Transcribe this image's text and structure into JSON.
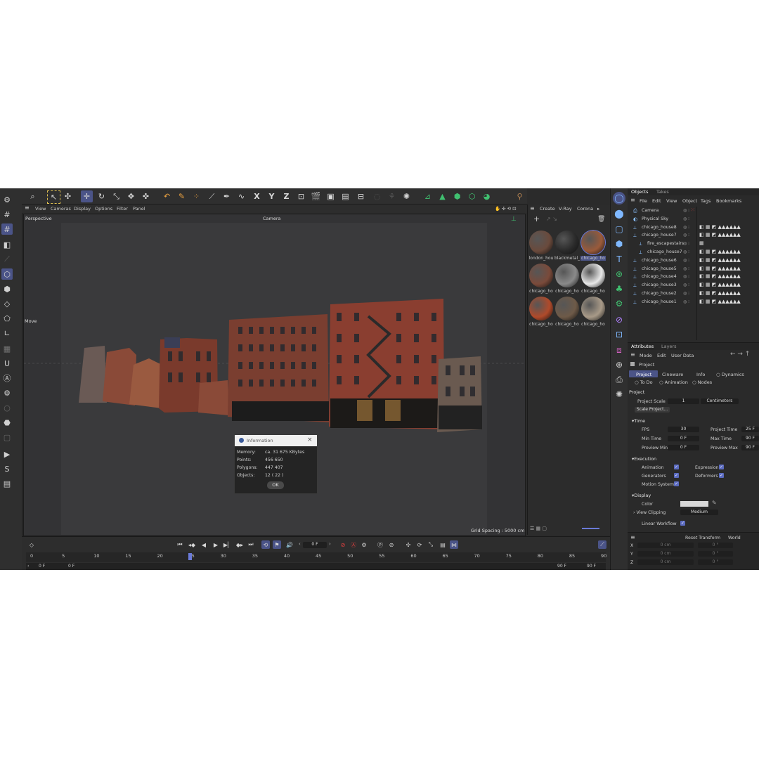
{
  "viewport": {
    "menu": [
      "View",
      "Cameras",
      "Display",
      "Options",
      "Filter",
      "Panel"
    ],
    "name": "Perspective",
    "camera_label": "Camera",
    "tool_label": "Move",
    "grid_spacing": "Grid Spacing : 5000 cm"
  },
  "toolbar": {
    "axes": [
      "X",
      "Y",
      "Z"
    ]
  },
  "materials": {
    "menu": [
      "Create",
      "V-Ray",
      "Corona"
    ],
    "items": [
      {
        "label": "london_hou",
        "color": "#6a4a3c"
      },
      {
        "label": "blackmetal_",
        "color": "#2a2a2a"
      },
      {
        "label": "chicago_ho",
        "color": "#9a5a3a"
      },
      {
        "label": "chicago_ho",
        "color": "#7a4a3a"
      },
      {
        "label": "chicago_ho",
        "color": "#8a8a8a"
      },
      {
        "label": "chicago_ho",
        "color": "#e8e8e8"
      },
      {
        "label": "chicago_ho",
        "color": "#b04a2a"
      },
      {
        "label": "chicago_ho",
        "color": "#6e5a48"
      },
      {
        "label": "chicago_ho",
        "color": "#a89a88"
      }
    ]
  },
  "objects": {
    "tabs": [
      "Objects",
      "Takes"
    ],
    "menu": [
      "File",
      "Edit",
      "View",
      "Object",
      "Tags",
      "Bookmarks"
    ],
    "rows": [
      {
        "name": "Camera",
        "indent": 0
      },
      {
        "name": "Physical Sky",
        "indent": 0
      },
      {
        "name": "chicago_house8",
        "indent": 0
      },
      {
        "name": "chicago_house7",
        "indent": 0
      },
      {
        "name": "fire_escapestairs",
        "indent": 1
      },
      {
        "name": "chicago_house7",
        "indent": 1
      },
      {
        "name": "chicago_house6",
        "indent": 0
      },
      {
        "name": "chicago_house5",
        "indent": 0
      },
      {
        "name": "chicago_house4",
        "indent": 0
      },
      {
        "name": "chicago_house3",
        "indent": 0
      },
      {
        "name": "chicago_house2",
        "indent": 0
      },
      {
        "name": "chicago_house1",
        "indent": 0
      }
    ]
  },
  "attributes": {
    "tabs": [
      "Attributes",
      "Layers"
    ],
    "menu": [
      "Mode",
      "Edit",
      "User Data"
    ],
    "object_label": "Project",
    "subtabs": [
      "Project",
      "Cineware",
      "Info",
      "Dynamics",
      "To Do",
      "Animation",
      "Nodes"
    ],
    "section_project": "Project",
    "project_scale_label": "Project Scale",
    "project_scale_value": "1",
    "project_scale_unit": "Centimeters",
    "scale_button": "Scale Project...",
    "time_section": "Time",
    "fps_label": "FPS",
    "fps_value": "30",
    "project_time_label": "Project Time",
    "project_time_value": "25 F",
    "min_time_label": "Min Time",
    "min_time_value": "0 F",
    "max_time_label": "Max Time",
    "max_time_value": "90 F",
    "preview_min_label": "Preview Min",
    "preview_min_value": "0 F",
    "preview_max_label": "Preview Max",
    "preview_max_value": "90 F",
    "execution_section": "Execution",
    "animation_label": "Animation",
    "expression_label": "Expression",
    "generators_label": "Generators",
    "deformers_label": "Deformers",
    "motion_system_label": "Motion System",
    "display_section": "Display",
    "color_label": "Color",
    "view_clipping_label": "View Clipping",
    "view_clipping_value": "Medium",
    "linear_workflow_label": "Linear Workflow",
    "reset_transform": "Reset Transform",
    "world": "World",
    "coords": [
      {
        "axis": "X",
        "value": "0 cm",
        "rot": "0 °"
      },
      {
        "axis": "Y",
        "value": "0 cm",
        "rot": "0 °"
      },
      {
        "axis": "Z",
        "value": "0 cm",
        "rot": "0 °"
      }
    ]
  },
  "dialog": {
    "title": "Information",
    "memory_label": "Memory:",
    "memory_value": "ca. 31 675 KBytes",
    "points_label": "Points:",
    "points_value": "456 650",
    "polygons_label": "Polygons:",
    "polygons_value": "447 407",
    "objects_label": "Objects:",
    "objects_value": "12 ( 22 )",
    "ok_label": "OK"
  },
  "timeline": {
    "current_frame": "0 F",
    "ticks": [
      "0",
      "5",
      "10",
      "15",
      "20",
      "25",
      "30",
      "35",
      "40",
      "45",
      "50",
      "55",
      "60",
      "65",
      "70",
      "75",
      "80",
      "85",
      "90"
    ],
    "start": "0 F",
    "start2": "0 F",
    "end": "90 F",
    "end2": "90 F"
  }
}
